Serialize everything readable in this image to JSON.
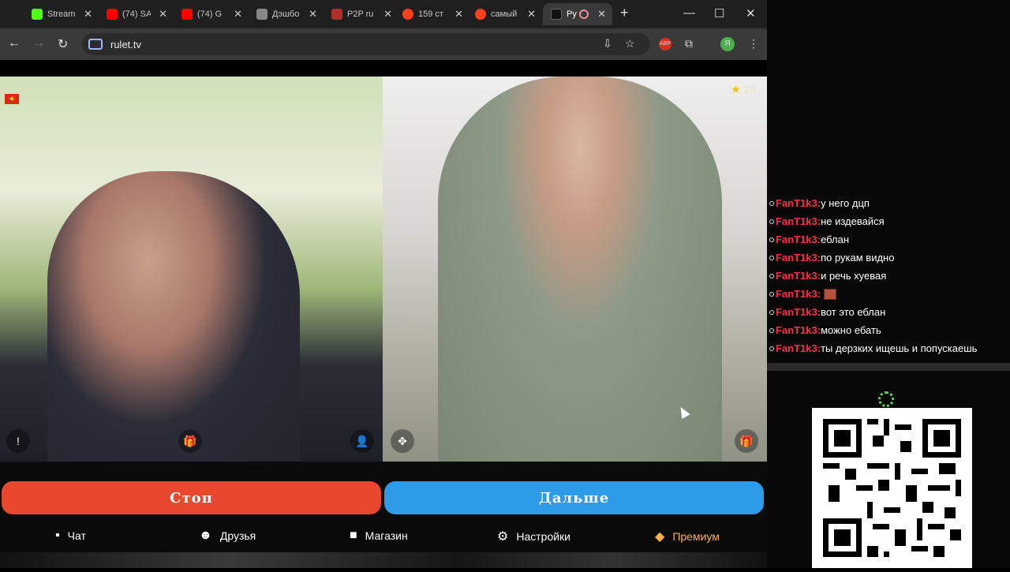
{
  "browser": {
    "tabs": [
      {
        "title": "Stream",
        "icon": "k-green-icon",
        "color": "#53fc18"
      },
      {
        "title": "(74) SA",
        "icon": "youtube-icon",
        "color": "#ff0000"
      },
      {
        "title": "(74) G",
        "icon": "youtube-icon",
        "color": "#ff0000"
      },
      {
        "title": "Дэшбо",
        "icon": "dots-icon",
        "color": "#888888"
      },
      {
        "title": "P2P ru",
        "icon": "p2p-icon",
        "color": "#b0302a"
      },
      {
        "title": "159 ст",
        "icon": "yandex-icon",
        "color": "#fc3f1d"
      },
      {
        "title": "самый",
        "icon": "yandex-icon",
        "color": "#fc3f1d"
      },
      {
        "title": "Ру",
        "icon": "rulet-icon",
        "color": "#222222"
      }
    ],
    "url": "rulet.tv"
  },
  "video": {
    "left_flag": "★",
    "right_score": "25"
  },
  "buttons": {
    "stop": "Стоп",
    "next": "Дальше"
  },
  "nav": {
    "chat": "Чат",
    "friends": "Друзья",
    "shop": "Магазин",
    "settings": "Настройки",
    "premium": "Премиум"
  },
  "chat": {
    "messages": [
      {
        "user": "FanT1k3:",
        "text": "у него дцп"
      },
      {
        "user": "FanT1k3:",
        "text": "не издевайся"
      },
      {
        "user": "FanT1k3:",
        "text": "еблан"
      },
      {
        "user": "FanT1k3:",
        "text": "по рукам видно"
      },
      {
        "user": "FanT1k3:",
        "text": "и речь хуевая"
      },
      {
        "user": "FanT1k3:",
        "text": ""
      },
      {
        "user": "FanT1k3:",
        "text": "вот это еблан"
      },
      {
        "user": "FanT1k3:",
        "text": "можно ебать"
      },
      {
        "user": "FanT1k3:",
        "text": "ты дерзких ищешь и попускаешь"
      }
    ]
  }
}
